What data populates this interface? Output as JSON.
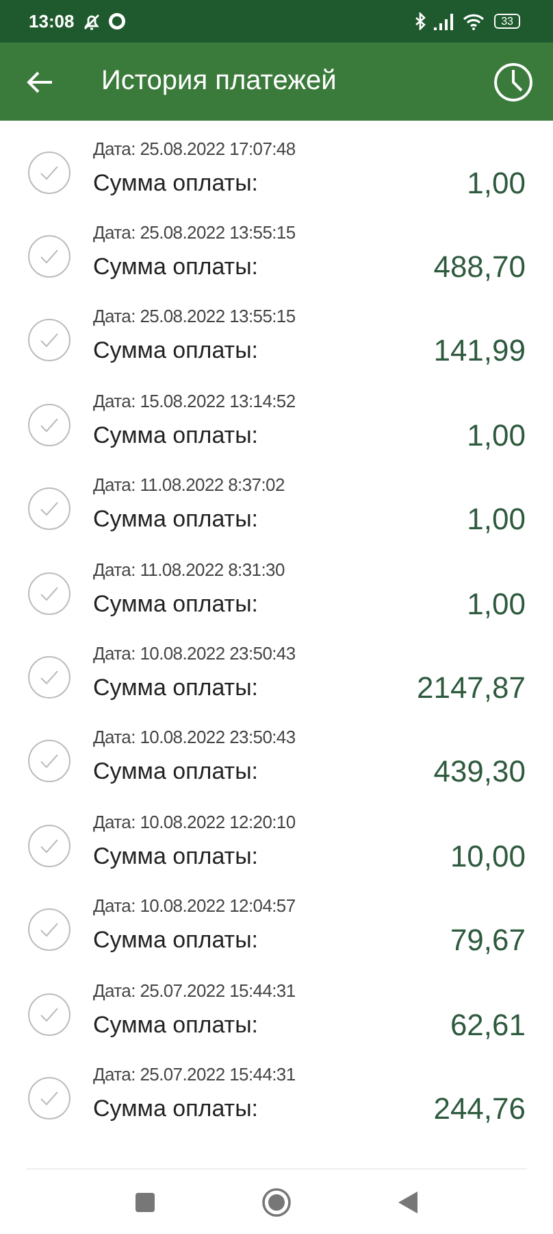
{
  "status_bar": {
    "time": "13:08",
    "battery": "33"
  },
  "header": {
    "title": "История платежей"
  },
  "payments": [
    {
      "date": "Дата: 25.08.2022 17:07:48",
      "label": "Сумма оплаты:",
      "amount": "1,00"
    },
    {
      "date": "Дата: 25.08.2022 13:55:15",
      "label": "Сумма оплаты:",
      "amount": "488,70"
    },
    {
      "date": "Дата: 25.08.2022 13:55:15",
      "label": "Сумма оплаты:",
      "amount": "141,99"
    },
    {
      "date": "Дата: 15.08.2022 13:14:52",
      "label": "Сумма оплаты:",
      "amount": "1,00"
    },
    {
      "date": "Дата: 11.08.2022 8:37:02",
      "label": "Сумма оплаты:",
      "amount": "1,00"
    },
    {
      "date": "Дата: 11.08.2022 8:31:30",
      "label": "Сумма оплаты:",
      "amount": "1,00"
    },
    {
      "date": "Дата: 10.08.2022 23:50:43",
      "label": "Сумма оплаты:",
      "amount": "2147,87"
    },
    {
      "date": "Дата: 10.08.2022 23:50:43",
      "label": "Сумма оплаты:",
      "amount": "439,30"
    },
    {
      "date": "Дата: 10.08.2022 12:20:10",
      "label": "Сумма оплаты:",
      "amount": "10,00"
    },
    {
      "date": "Дата: 10.08.2022 12:04:57",
      "label": "Сумма оплаты:",
      "amount": "79,67"
    },
    {
      "date": "Дата: 25.07.2022 15:44:31",
      "label": "Сумма оплаты:",
      "amount": "62,61"
    },
    {
      "date": "Дата: 25.07.2022 15:44:31",
      "label": "Сумма оплаты:",
      "amount": "244,76"
    }
  ]
}
